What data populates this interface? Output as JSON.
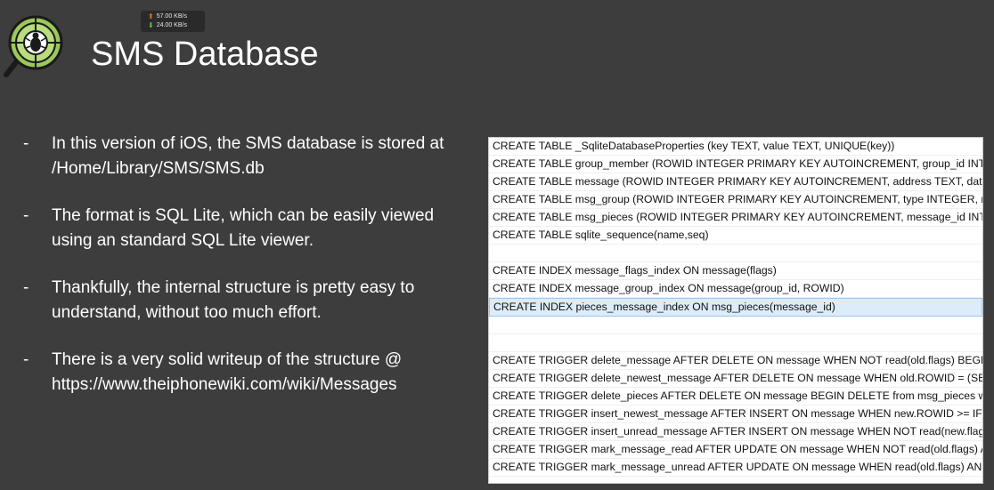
{
  "header": {
    "title": "SMS Database",
    "net_upload": "57.00 KB/s",
    "net_download": "24.00 KB/s"
  },
  "bullets": [
    "In this version of iOS, the SMS database is stored at /Home/Library/SMS/SMS.db",
    "The format is SQL Lite, which can be easily viewed using an standard SQL Lite viewer.",
    "Thankfully, the internal structure is pretty easy to understand, without too much effort.",
    "There is a very solid writeup of the structure @ https://www.theiphonewiki.com/wiki/Messages"
  ],
  "sql_rows": [
    "CREATE TABLE _SqliteDatabaseProperties (key TEXT, value TEXT, UNIQUE(key))",
    "CREATE TABLE group_member (ROWID INTEGER PRIMARY KEY AUTOINCREMENT, group_id INTE",
    "CREATE TABLE message (ROWID INTEGER PRIMARY KEY AUTOINCREMENT, address TEXT, date IN",
    "CREATE TABLE msg_group (ROWID INTEGER PRIMARY KEY AUTOINCREMENT, type INTEGER, new",
    "CREATE TABLE msg_pieces (ROWID INTEGER PRIMARY KEY AUTOINCREMENT, message_id INTEG",
    "CREATE TABLE sqlite_sequence(name,seq)",
    "",
    "CREATE INDEX message_flags_index ON message(flags)",
    "CREATE INDEX message_group_index ON message(group_id, ROWID)",
    "CREATE INDEX pieces_message_index ON msg_pieces(message_id)",
    "",
    "",
    "CREATE TRIGGER delete_message AFTER DELETE ON message WHEN NOT read(old.flags) BEGIN U",
    "CREATE TRIGGER delete_newest_message AFTER DELETE ON message WHEN old.ROWID = (SELEC",
    "CREATE TRIGGER delete_pieces AFTER DELETE ON message BEGIN DELETE from msg_pieces where",
    "CREATE TRIGGER insert_newest_message AFTER INSERT ON message WHEN new.ROWID >= IFNU",
    "CREATE TRIGGER insert_unread_message AFTER INSERT ON message WHEN NOT read(new.flags)",
    "CREATE TRIGGER mark_message_read AFTER UPDATE ON message WHEN NOT read(old.flags) AN",
    "CREATE TRIGGER mark_message_unread AFTER UPDATE ON message WHEN read(old.flags) AND"
  ],
  "selected_row": 9
}
